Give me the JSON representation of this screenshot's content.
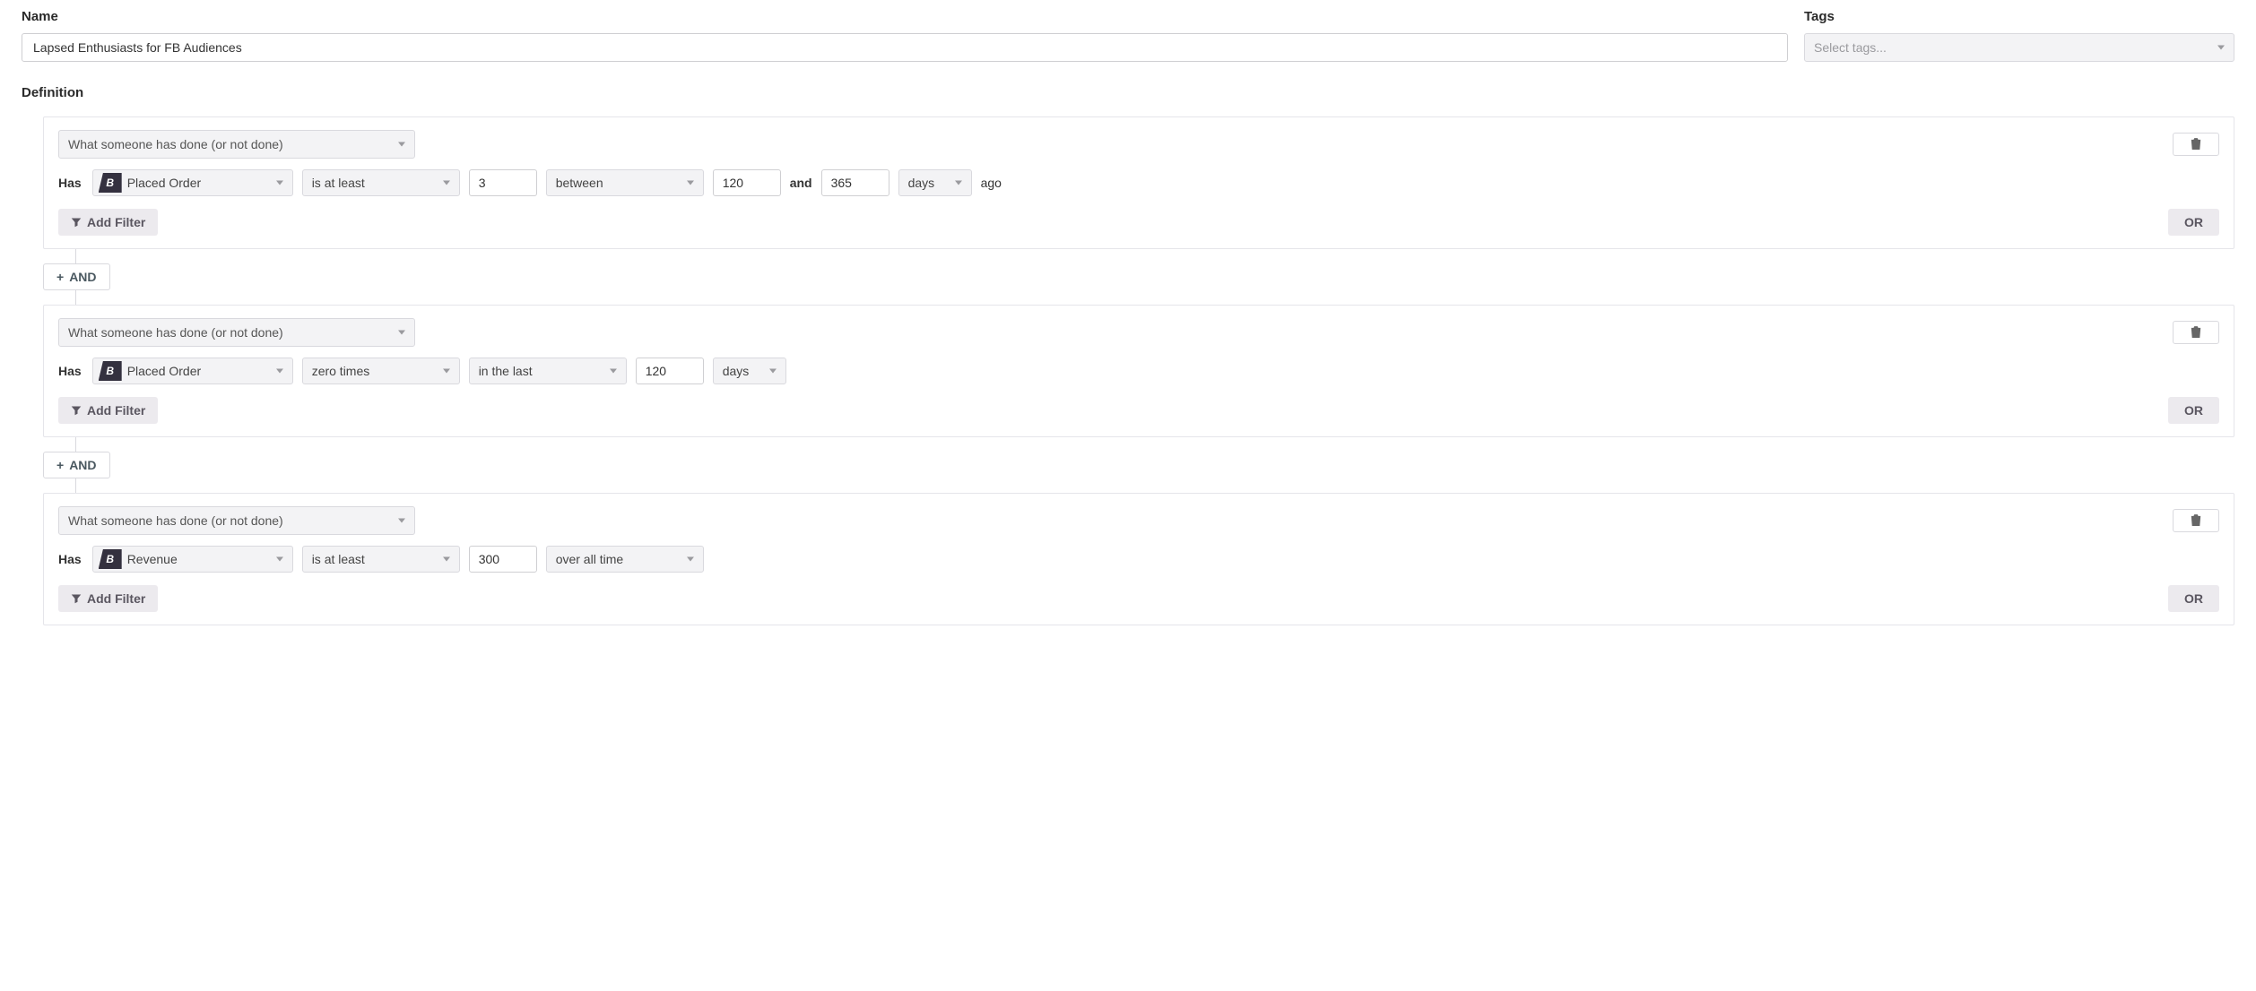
{
  "labels": {
    "name": "Name",
    "tags": "Tags",
    "definition": "Definition",
    "tags_placeholder": "Select tags...",
    "has": "Has",
    "and_word": "and",
    "ago": "ago",
    "add_filter": "Add Filter",
    "or": "OR",
    "and_btn": "AND"
  },
  "name_value": "Lapsed Enthusiasts for FB Audiences",
  "blocks": [
    {
      "type": "What someone has done (or not done)",
      "metric": "Placed Order",
      "operator": "is at least",
      "count": "3",
      "range": "between",
      "range_from": "120",
      "range_to": "365",
      "unit": "days",
      "suffix": "ago"
    },
    {
      "type": "What someone has done (or not done)",
      "metric": "Placed Order",
      "operator": "zero times",
      "range": "in the last",
      "range_from": "120",
      "unit": "days"
    },
    {
      "type": "What someone has done (or not done)",
      "metric": "Revenue",
      "operator": "is at least",
      "count": "300",
      "range": "over all time"
    }
  ]
}
